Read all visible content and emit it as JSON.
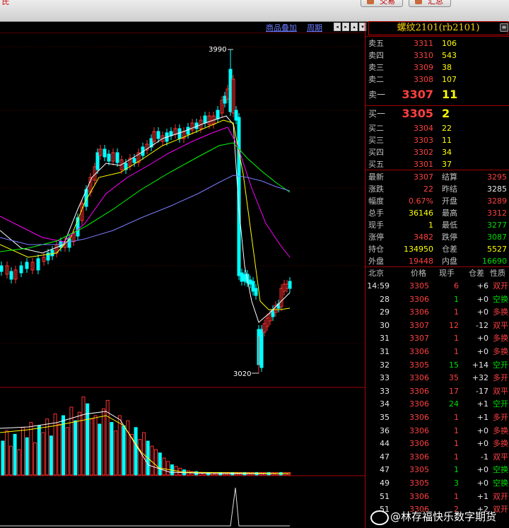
{
  "top_bar": {
    "corner": "氏",
    "buttons": [
      {
        "label": "交易"
      },
      {
        "label": "汇总"
      }
    ]
  },
  "chart_toolbar": {
    "links": [
      {
        "label": "商品叠加"
      },
      {
        "label": "周期"
      }
    ],
    "icons": [
      "左",
      "右",
      "上",
      "下"
    ]
  },
  "chart_data": {
    "type": "candlestick",
    "annotations": [
      {
        "label": "3990"
      },
      {
        "label": "3020"
      }
    ],
    "colors": {
      "up": "#ff3030",
      "down": "#00ffff",
      "ma5": "#ffffff",
      "ma10": "#ffff00",
      "ma20": "#ff00ff",
      "ma40": "#00ff00",
      "ma60": "#7b7bff"
    }
  },
  "quote": {
    "title": "螺纹2101(rb2101)",
    "asks": [
      {
        "label": "卖五",
        "price": "3311",
        "volume": "106"
      },
      {
        "label": "卖四",
        "price": "3310",
        "volume": "543"
      },
      {
        "label": "卖三",
        "price": "3309",
        "volume": "38"
      },
      {
        "label": "卖二",
        "price": "3308",
        "volume": "107"
      },
      {
        "label": "卖一",
        "price": "3307",
        "volume": "11"
      }
    ],
    "bids": [
      {
        "label": "买一",
        "price": "3305",
        "volume": "2"
      },
      {
        "label": "买二",
        "price": "3304",
        "volume": "22"
      },
      {
        "label": "买三",
        "price": "3303",
        "volume": "11"
      },
      {
        "label": "买四",
        "price": "3302",
        "volume": "34"
      },
      {
        "label": "买五",
        "price": "3301",
        "volume": "37"
      }
    ],
    "stats": [
      {
        "l1": "最新",
        "v1": "3307",
        "l2": "结算",
        "v2": "3295"
      },
      {
        "l1": "涨跌",
        "v1": "22",
        "l2": "昨结",
        "v2": "3285"
      },
      {
        "l1": "幅度",
        "v1": "0.67%",
        "l2": "开盘",
        "v2": "3289"
      },
      {
        "l1": "总手",
        "v1": "36146",
        "l2": "最高",
        "v2": "3312"
      },
      {
        "l1": "现手",
        "v1": "1",
        "l2": "最低",
        "v2": "3277"
      },
      {
        "l1": "涨停",
        "v1": "3482",
        "l2": "跌停",
        "v2": "3087"
      },
      {
        "l1": "持仓",
        "v1": "134950",
        "l2": "仓差",
        "v2": "5527"
      },
      {
        "l1": "外盘",
        "v1": "19448",
        "l2": "内盘",
        "v2": "16690"
      }
    ]
  },
  "ticks_header": {
    "time": "北京",
    "price": "价格",
    "vol": "现手",
    "chg": "仓差",
    "nature": "性质"
  },
  "ticks": [
    {
      "t": "14:59",
      "p": "3305",
      "v": "6",
      "c": "+6",
      "n": "双开"
    },
    {
      "t": "28",
      "p": "3306",
      "v": "1",
      "c": "+0",
      "n": "空换"
    },
    {
      "t": "29",
      "p": "3306",
      "v": "1",
      "c": "+0",
      "n": "多换"
    },
    {
      "t": "30",
      "p": "3307",
      "v": "12",
      "c": "-12",
      "n": "双平"
    },
    {
      "t": "31",
      "p": "3307",
      "v": "1",
      "c": "+0",
      "n": "多换"
    },
    {
      "t": "31",
      "p": "3306",
      "v": "1",
      "c": "+0",
      "n": "多换"
    },
    {
      "t": "32",
      "p": "3305",
      "v": "15",
      "c": "+14",
      "n": "空开"
    },
    {
      "t": "33",
      "p": "3306",
      "v": "35",
      "c": "+32",
      "n": "多开"
    },
    {
      "t": "33",
      "p": "3306",
      "v": "17",
      "c": "-17",
      "n": "双平"
    },
    {
      "t": "34",
      "p": "3306",
      "v": "24",
      "c": "+1",
      "n": "空开"
    },
    {
      "t": "35",
      "p": "3306",
      "v": "1",
      "c": "+1",
      "n": "多开"
    },
    {
      "t": "36",
      "p": "3306",
      "v": "1",
      "c": "+0",
      "n": "多换"
    },
    {
      "t": "44",
      "p": "3306",
      "v": "1",
      "c": "+0",
      "n": "多换"
    },
    {
      "t": "47",
      "p": "3306",
      "v": "1",
      "c": "-1",
      "n": "双平"
    },
    {
      "t": "47",
      "p": "3305",
      "v": "1",
      "c": "+0",
      "n": "空换"
    },
    {
      "t": "49",
      "p": "3305",
      "v": "3",
      "c": "+0",
      "n": "空换"
    },
    {
      "t": "51",
      "p": "3306",
      "v": "1",
      "c": "+1",
      "n": "双开"
    },
    {
      "t": "51",
      "p": "3306",
      "v": "2",
      "c": "+2",
      "n": "双开"
    }
  ],
  "watermark": "@林存福快乐数字期货"
}
